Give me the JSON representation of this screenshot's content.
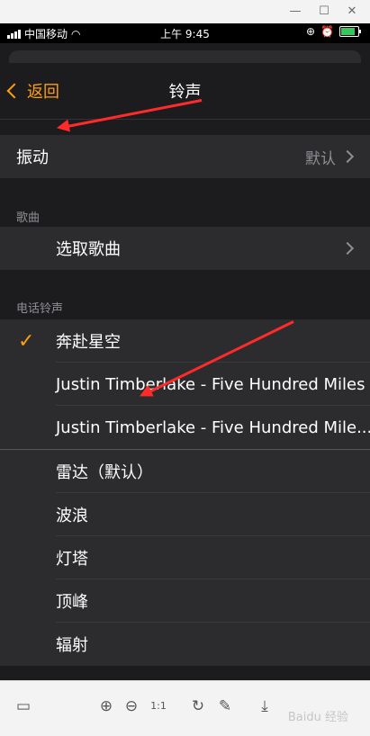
{
  "status": {
    "carrier": "中国移动",
    "time": "上午 9:45"
  },
  "nav": {
    "back_label": "返回",
    "title": "铃声"
  },
  "vibration": {
    "label": "振动",
    "value": "默认"
  },
  "songs": {
    "header": "歌曲",
    "pick_label": "选取歌曲"
  },
  "ringtones": {
    "header": "电话铃声",
    "items": [
      "奔赴星空",
      "Justin Timberlake - Five Hundred Miles",
      "Justin Timberlake - Five Hundred Mile...",
      "雷达（默认）",
      "波浪",
      "灯塔",
      "顶峰",
      "辐射"
    ],
    "selected_index": 0
  },
  "watermark": "Baidu 经验",
  "colors": {
    "accent": "#ff9f0a",
    "annotation": "#ff2a2a"
  }
}
